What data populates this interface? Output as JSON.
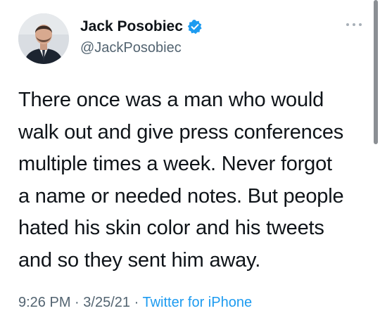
{
  "tweet": {
    "author": {
      "display_name": "Jack Posobiec",
      "handle": "@JackPosobiec",
      "verified_icon": "verified-badge-icon",
      "avatar_icon": "profile-photo"
    },
    "more_icon": "more-options-icon",
    "text_lines": [
      "There once was a man who would",
      "walk out and give press conferences",
      "multiple times a week. Never forgot",
      "a name or needed notes. But people",
      "hated his skin color and his tweets",
      "and so they sent him away."
    ],
    "time": "9:26 PM",
    "date": "3/25/21",
    "separator": "·",
    "source": "Twitter for iPhone"
  },
  "colors": {
    "text": "#0f1419",
    "secondary": "#536471",
    "accent": "#1d9bf0"
  }
}
